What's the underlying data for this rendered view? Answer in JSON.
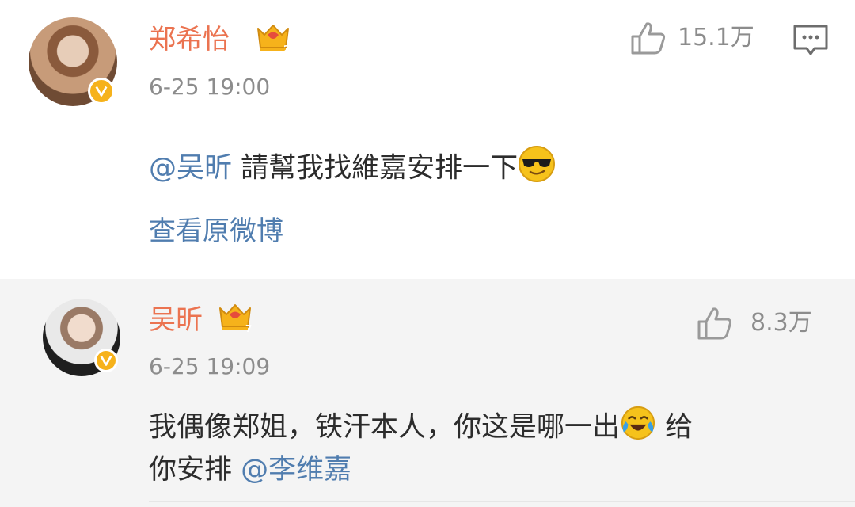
{
  "post": {
    "username": "郑希怡",
    "level": "2",
    "time": "6-25 19:00",
    "likes": "15.1万",
    "mention": "@吴昕",
    "text": " 請幫我找維嘉安排一下",
    "emoji": "sunglasses-emoji",
    "view_original": "查看原微博"
  },
  "reply": {
    "username": "吴昕",
    "level": "7",
    "time": "6-25 19:09",
    "likes": "8.3万",
    "text_line1": "我偶像郑姐，铁汗本人，你这是哪一出",
    "emoji": "laughing-crying-emoji",
    "text_line1_tail": " 给",
    "text_line2": "你安排 ",
    "mention": "@李维嘉"
  },
  "colors": {
    "username": "#eb7350",
    "link": "#507daf",
    "meta": "#8c8c8c",
    "badge": "#f6b21b",
    "crown": "#f6b21b",
    "reply_bg": "#f4f4f4"
  }
}
